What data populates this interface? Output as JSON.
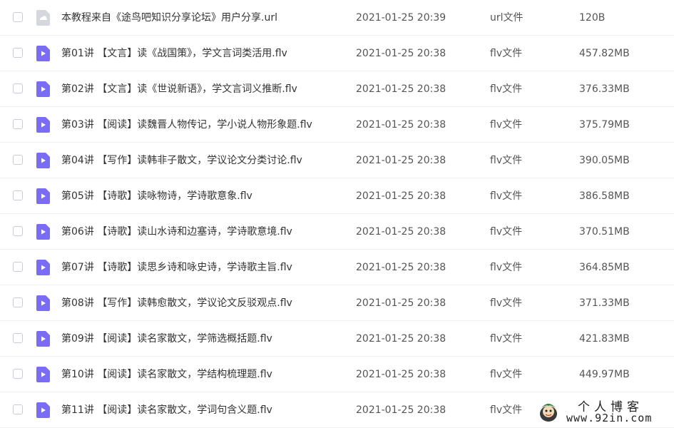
{
  "files": [
    {
      "name": "本教程来自《途鸟吧知识分享论坛》用户分享.url",
      "date": "2021-01-25 20:39",
      "type": "url文件",
      "size": "120B",
      "icon": "url-file-icon"
    },
    {
      "name": "第01讲 【文言】读《战国策》，学文言词类活用.flv",
      "date": "2021-01-25 20:38",
      "type": "flv文件",
      "size": "457.82MB",
      "icon": "video-file-icon"
    },
    {
      "name": "第02讲 【文言】读《世说新语》，学文言词义推断.flv",
      "date": "2021-01-25 20:38",
      "type": "flv文件",
      "size": "376.33MB",
      "icon": "video-file-icon"
    },
    {
      "name": "第03讲 【阅读】读魏晋人物传记，学小说人物形象题.flv",
      "date": "2021-01-25 20:38",
      "type": "flv文件",
      "size": "375.79MB",
      "icon": "video-file-icon"
    },
    {
      "name": "第04讲 【写作】读韩非子散文，学议论文分类讨论.flv",
      "date": "2021-01-25 20:38",
      "type": "flv文件",
      "size": "390.05MB",
      "icon": "video-file-icon"
    },
    {
      "name": "第05讲 【诗歌】读咏物诗，学诗歌意象.flv",
      "date": "2021-01-25 20:38",
      "type": "flv文件",
      "size": "386.58MB",
      "icon": "video-file-icon"
    },
    {
      "name": "第06讲 【诗歌】读山水诗和边塞诗，学诗歌意境.flv",
      "date": "2021-01-25 20:38",
      "type": "flv文件",
      "size": "370.51MB",
      "icon": "video-file-icon"
    },
    {
      "name": "第07讲 【诗歌】读思乡诗和咏史诗，学诗歌主旨.flv",
      "date": "2021-01-25 20:38",
      "type": "flv文件",
      "size": "364.85MB",
      "icon": "video-file-icon"
    },
    {
      "name": "第08讲 【写作】读韩愈散文，学议论文反驳观点.flv",
      "date": "2021-01-25 20:38",
      "type": "flv文件",
      "size": "371.33MB",
      "icon": "video-file-icon"
    },
    {
      "name": "第09讲 【阅读】读名家散文，学筛选概括题.flv",
      "date": "2021-01-25 20:38",
      "type": "flv文件",
      "size": "421.83MB",
      "icon": "video-file-icon"
    },
    {
      "name": "第10讲 【阅读】读名家散文，学结构梳理题.flv",
      "date": "2021-01-25 20:38",
      "type": "flv文件",
      "size": "449.97MB",
      "icon": "video-file-icon"
    },
    {
      "name": "第11讲 【阅读】读名家散文，学词句含义题.flv",
      "date": "2021-01-25 20:38",
      "type": "flv文件",
      "size": "",
      "icon": "video-file-icon"
    }
  ],
  "watermark": {
    "title": "个人博客",
    "url": "www.92in.com"
  },
  "colors": {
    "video_icon": "#7b6cf6",
    "url_icon": "#d5d7de",
    "row_divider": "#f1f1f4",
    "checkbox_border": "#c9ccd6"
  }
}
